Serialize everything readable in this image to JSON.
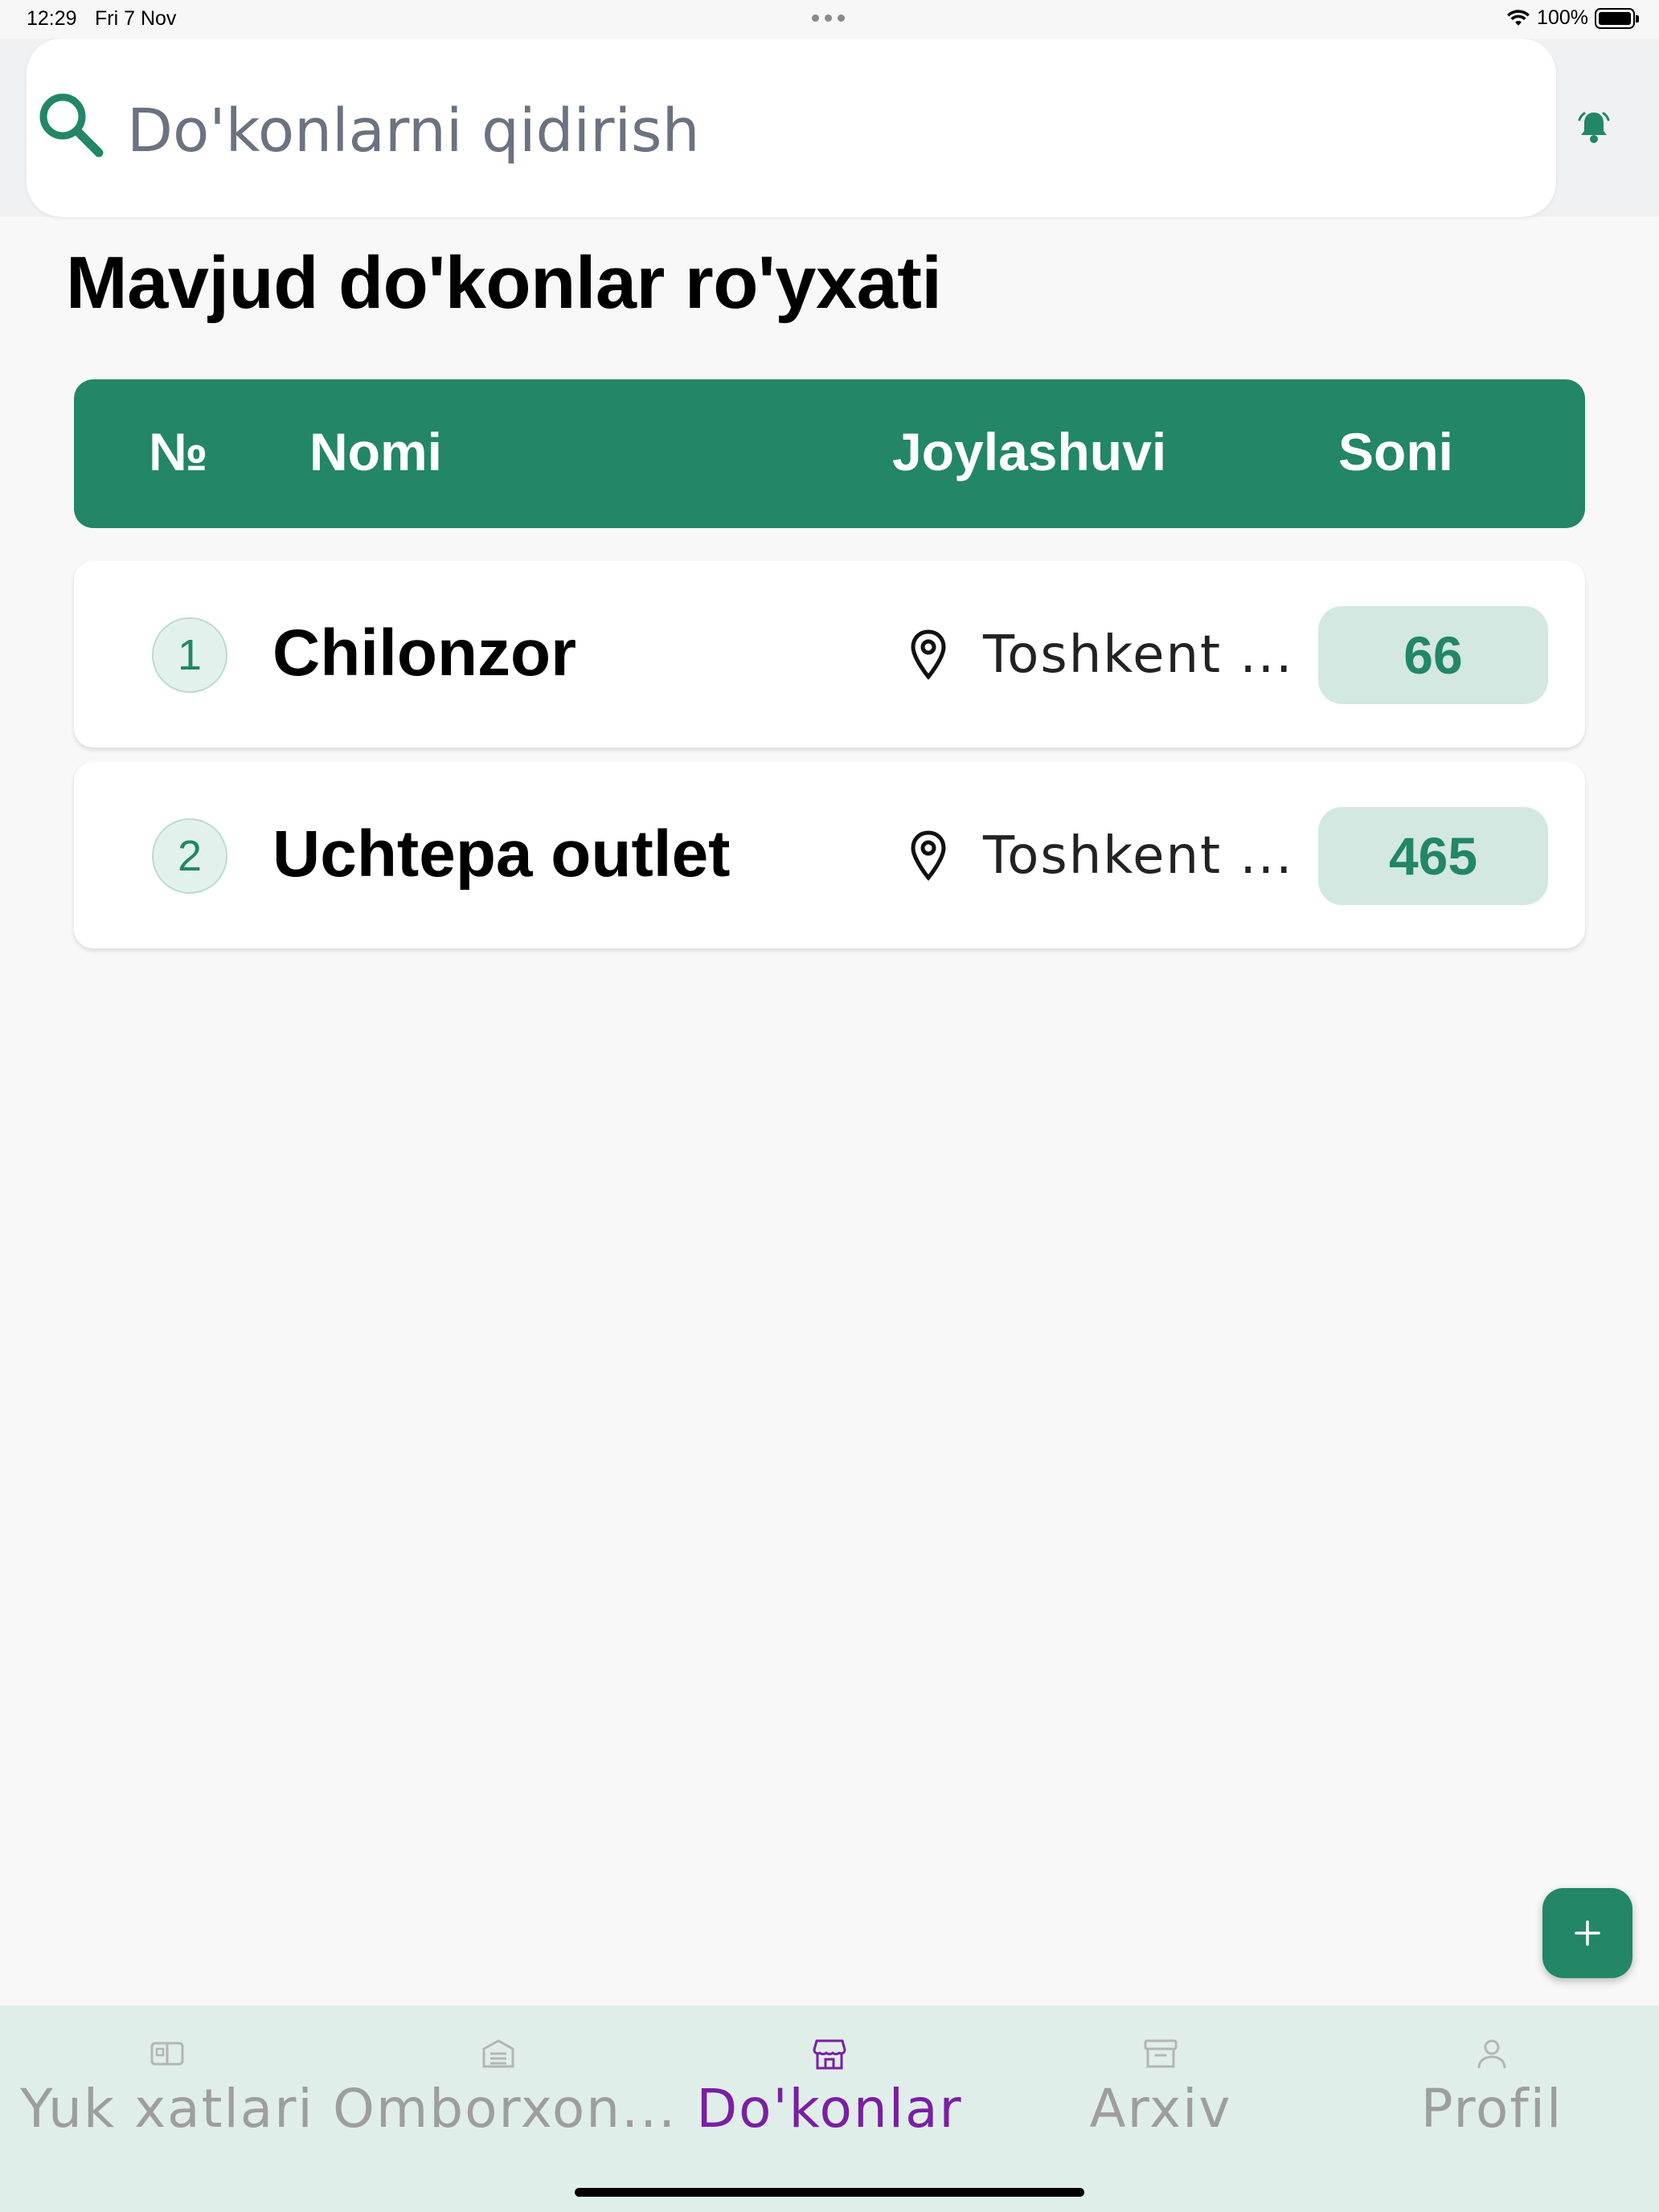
{
  "status_bar": {
    "time": "12:29",
    "date": "Fri 7 Nov",
    "battery": "100%",
    "battery_level": 1.0
  },
  "search": {
    "placeholder": "Do'konlarni qidirish",
    "icon": "search-icon"
  },
  "header": {
    "bell_icon": "bell-icon"
  },
  "page": {
    "title": "Mavjud do'konlar ro'yxati"
  },
  "table": {
    "columns": [
      "№",
      "Nomi",
      "Joylashuvi",
      "Soni"
    ],
    "rows": [
      {
        "number": "1",
        "name": "Chilonzor",
        "location": "Toshkent ...",
        "count": "66"
      },
      {
        "number": "2",
        "name": "Uchtepa outlet",
        "location": "Toshkent ...",
        "count": "465"
      }
    ]
  },
  "fab": {
    "icon": "plus-icon"
  },
  "bottom_nav": {
    "items": [
      {
        "label": "Yuk xatlari",
        "icon": "waybill-icon",
        "active": false
      },
      {
        "label": "Omborxon...",
        "icon": "warehouse-icon",
        "active": false
      },
      {
        "label": "Do'konlar",
        "icon": "store-icon",
        "active": true
      },
      {
        "label": "Arxiv",
        "icon": "archive-icon",
        "active": false
      },
      {
        "label": "Profil",
        "icon": "profile-icon",
        "active": false
      }
    ]
  },
  "colors": {
    "primary": "#228667",
    "primary_light": "#d2e8e1",
    "active_nav": "#7a1fa2",
    "inactive_nav": "#9e9e9e",
    "nav_background": "#e0eeea"
  }
}
